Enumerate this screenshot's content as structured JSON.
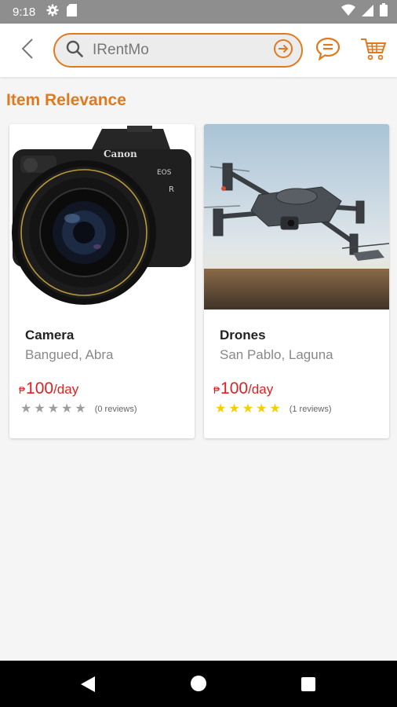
{
  "status_bar": {
    "time": "9:18",
    "left_icons": [
      "gear-icon",
      "sd-card-icon"
    ],
    "right_icons": [
      "wifi-icon",
      "signal-icon",
      "battery-icon"
    ]
  },
  "app_bar": {
    "search": {
      "value": "IRentMo",
      "placeholder": ""
    },
    "icons": [
      "back-arrow-icon",
      "search-icon",
      "arrow-circle-right-icon",
      "chat-icon",
      "cart-icon"
    ]
  },
  "section_title": "Item Relevance",
  "colors": {
    "accent": "#e07a1f",
    "price": "#e02020",
    "star_filled": "#f5d000",
    "star_empty": "#9e9e9e"
  },
  "products": [
    {
      "name": "Camera",
      "location": "Bangued, Abra",
      "currency": "₱",
      "price": "100",
      "unit": "/day",
      "rating": 0,
      "reviews": "(0 reviews)",
      "image": "camera-photo"
    },
    {
      "name": "Drones",
      "location": "San Pablo, Laguna",
      "currency": "₱",
      "price": "100",
      "unit": "/day",
      "rating": 5,
      "reviews": "(1 reviews)",
      "image": "drone-photo"
    }
  ],
  "nav_bar": {
    "icons": [
      "nav-back-icon",
      "nav-home-icon",
      "nav-recents-icon"
    ]
  }
}
